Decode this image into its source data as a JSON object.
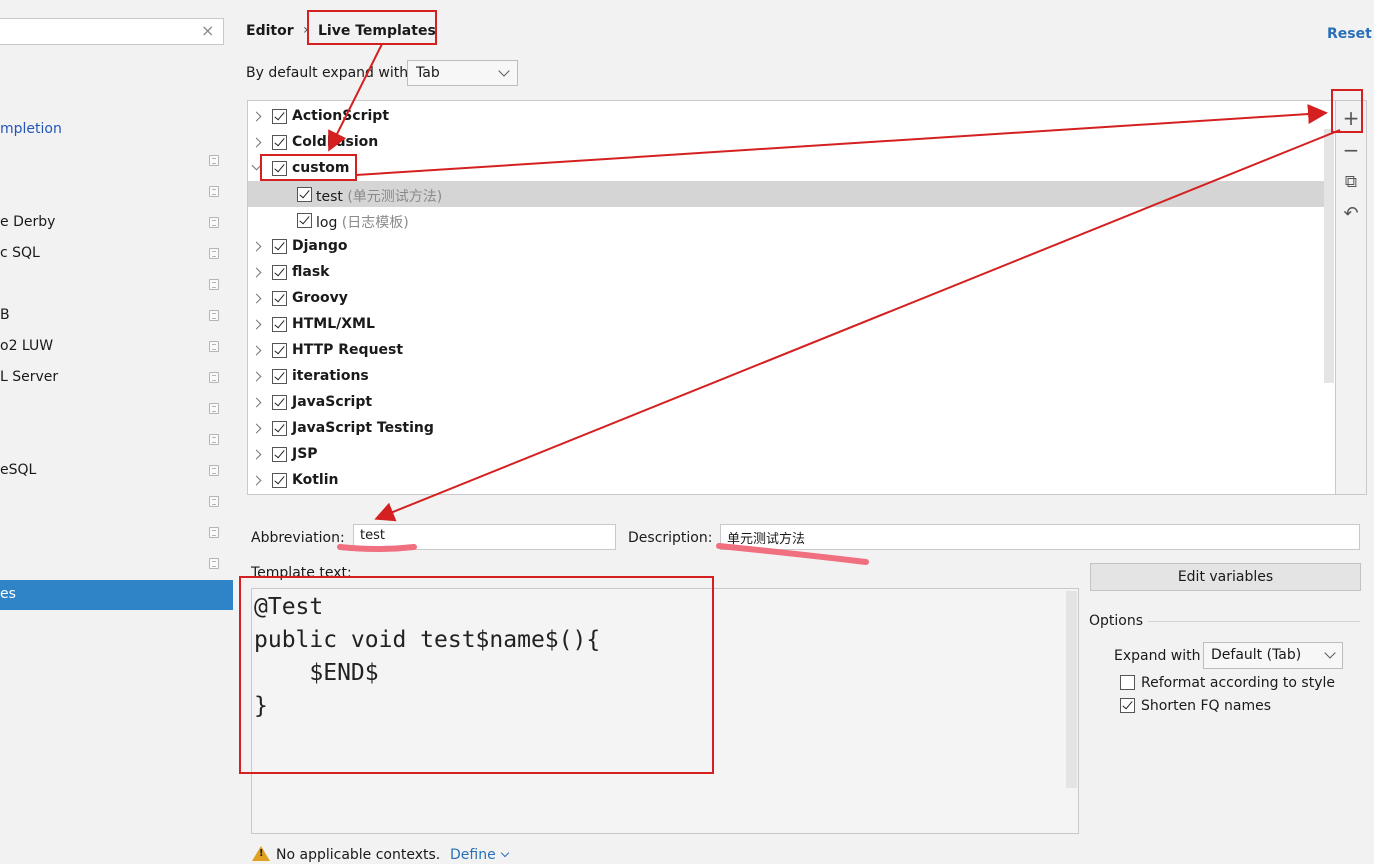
{
  "sidebar": {
    "items": [
      {
        "label": "mpletion",
        "icon": false,
        "link": true
      },
      {
        "label": "",
        "icon": true
      },
      {
        "label": "",
        "icon": true
      },
      {
        "label": "e Derby",
        "icon": true
      },
      {
        "label": "c SQL",
        "icon": true
      },
      {
        "label": "",
        "icon": true
      },
      {
        "label": "B",
        "icon": true
      },
      {
        "label": "o2 LUW",
        "icon": true
      },
      {
        "label": "L Server",
        "icon": true
      },
      {
        "label": "",
        "icon": true
      },
      {
        "label": "",
        "icon": true
      },
      {
        "label": "eSQL",
        "icon": true
      },
      {
        "label": "",
        "icon": true
      },
      {
        "label": "",
        "icon": true
      },
      {
        "label": "",
        "icon": true
      }
    ],
    "selected_label": "es",
    "search_clear": "×"
  },
  "breadcrumb": {
    "parent": "Editor",
    "separator": "›",
    "current": "Live Templates"
  },
  "reset_label": "Reset",
  "expand_default": {
    "label": "By default expand with",
    "value": "Tab"
  },
  "tree": {
    "groups": [
      {
        "name": "ActionScript",
        "checked": true,
        "expanded": false
      },
      {
        "name": "ColdFusion",
        "checked": true,
        "expanded": false
      },
      {
        "name": "custom",
        "checked": true,
        "expanded": true,
        "children": [
          {
            "name": "test",
            "desc": " (单元测试方法)",
            "checked": true,
            "selected": true
          },
          {
            "name": "log",
            "desc": " (日志模板)",
            "checked": true,
            "selected": false
          }
        ]
      },
      {
        "name": "Django",
        "checked": true,
        "expanded": false
      },
      {
        "name": "flask",
        "checked": true,
        "expanded": false
      },
      {
        "name": "Groovy",
        "checked": true,
        "expanded": false
      },
      {
        "name": "HTML/XML",
        "checked": true,
        "expanded": false
      },
      {
        "name": "HTTP Request",
        "checked": true,
        "expanded": false
      },
      {
        "name": "iterations",
        "checked": true,
        "expanded": false
      },
      {
        "name": "JavaScript",
        "checked": true,
        "expanded": false
      },
      {
        "name": "JavaScript Testing",
        "checked": true,
        "expanded": false
      },
      {
        "name": "JSP",
        "checked": true,
        "expanded": false
      },
      {
        "name": "Kotlin",
        "checked": true,
        "expanded": false
      }
    ]
  },
  "toolbar": {
    "add": "+",
    "remove": "−",
    "copy": "⧉",
    "restore": "↶"
  },
  "abbreviation": {
    "label": "Abbreviation:",
    "value": "test"
  },
  "description": {
    "label": "Description:",
    "value": "单元测试方法"
  },
  "template_text": {
    "label": "Template text:",
    "value": "@Test\npublic void test$name$(){\n    $END$\n}"
  },
  "edit_variables_label": "Edit variables",
  "options": {
    "title": "Options",
    "expand_with_label": "Expand with",
    "expand_with_value": "Default (Tab)",
    "reformat": {
      "label": "Reformat according to style",
      "checked": false
    },
    "shorten": {
      "label": "Shorten FQ names",
      "checked": true
    }
  },
  "context": {
    "warning": "No applicable contexts.",
    "define_label": "Define"
  },
  "colors": {
    "selection": "#2e84c7",
    "link": "#2a70b8",
    "annotation": "#d42020",
    "highlight": "#f07080"
  }
}
